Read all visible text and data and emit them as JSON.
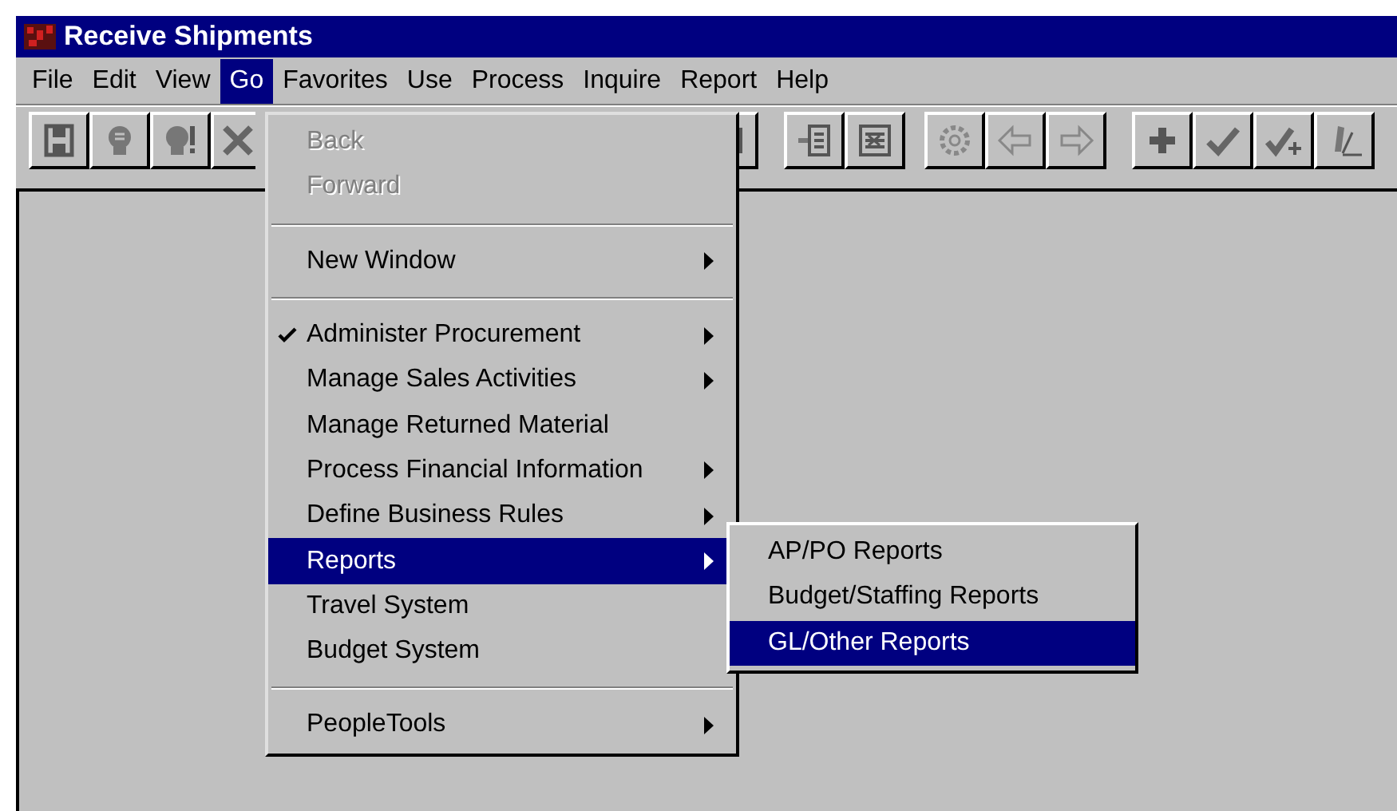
{
  "window": {
    "title": "Receive Shipments"
  },
  "menu_bar": [
    {
      "label": "File",
      "selected": false
    },
    {
      "label": "Edit",
      "selected": false
    },
    {
      "label": "View",
      "selected": false
    },
    {
      "label": "Go",
      "selected": true
    },
    {
      "label": "Favorites",
      "selected": false
    },
    {
      "label": "Use",
      "selected": false
    },
    {
      "label": "Process",
      "selected": false
    },
    {
      "label": "Inquire",
      "selected": false
    },
    {
      "label": "Report",
      "selected": false
    },
    {
      "label": "Help",
      "selected": false
    }
  ],
  "go_menu": [
    {
      "kind": "item",
      "label": "Back",
      "disabled": true,
      "checked": false,
      "submenu": false,
      "selected": false
    },
    {
      "kind": "item",
      "label": "Forward",
      "disabled": true,
      "checked": false,
      "submenu": false,
      "selected": false
    },
    {
      "kind": "separator"
    },
    {
      "kind": "item",
      "label": "New Window",
      "disabled": false,
      "checked": false,
      "submenu": true,
      "selected": false
    },
    {
      "kind": "separator"
    },
    {
      "kind": "item",
      "label": "Administer Procurement",
      "disabled": false,
      "checked": true,
      "submenu": true,
      "selected": false
    },
    {
      "kind": "item",
      "label": "Manage Sales Activities",
      "disabled": false,
      "checked": false,
      "submenu": true,
      "selected": false
    },
    {
      "kind": "item",
      "label": "Manage Returned Material",
      "disabled": false,
      "checked": false,
      "submenu": false,
      "selected": false
    },
    {
      "kind": "item",
      "label": "Process Financial Information",
      "disabled": false,
      "checked": false,
      "submenu": true,
      "selected": false
    },
    {
      "kind": "item",
      "label": "Define Business Rules",
      "disabled": false,
      "checked": false,
      "submenu": true,
      "selected": false
    },
    {
      "kind": "item",
      "label": "Reports",
      "disabled": false,
      "checked": false,
      "submenu": true,
      "selected": true
    },
    {
      "kind": "item",
      "label": "Travel System",
      "disabled": false,
      "checked": false,
      "submenu": false,
      "selected": false
    },
    {
      "kind": "item",
      "label": "Budget System",
      "disabled": false,
      "checked": false,
      "submenu": false,
      "selected": false
    },
    {
      "kind": "separator"
    },
    {
      "kind": "item",
      "label": "PeopleTools",
      "disabled": false,
      "checked": false,
      "submenu": true,
      "selected": false
    }
  ],
  "reports_submenu": [
    {
      "label": "AP/PO Reports",
      "selected": false
    },
    {
      "label": "Budget/Staffing Reports",
      "selected": false
    },
    {
      "label": "GL/Other Reports",
      "selected": true
    }
  ]
}
